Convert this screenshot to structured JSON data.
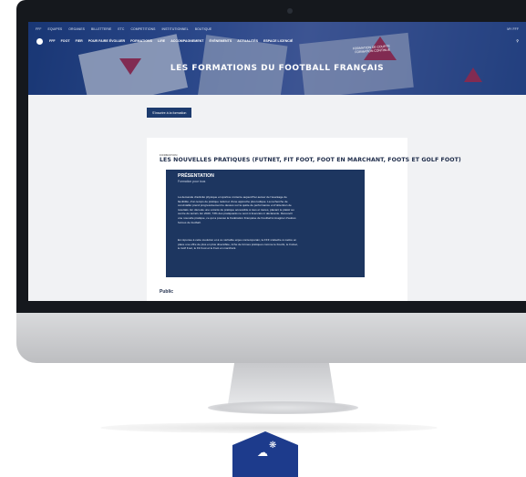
{
  "site": {
    "topbar": {
      "links": [
        "FFF",
        "EQUIPES",
        "ORGANES",
        "BILLETTERIE",
        "ETC",
        "COMPETITIONS",
        "INSTITUTIONNEL",
        "BOUTIQUE"
      ],
      "right": "MY FFF"
    },
    "nav": {
      "items": [
        "FFF",
        "FOOT",
        "FIER",
        "POUR FAIRE ÉVOLUER",
        "FORMATIONS",
        "LIRE",
        "ACCOMPAGNEMENT",
        "ÉVÉNEMENTS",
        "ACTUALITÉS",
        "ESPACE LICENCIÉ"
      ]
    },
    "hero": {
      "title": "LES FORMATIONS DU FOOTBALL FRANÇAIS",
      "badge_line1": "FORMATION DE COURTE",
      "badge_line2": "FORMATION CONTINUE"
    },
    "back_button": "S'inscrire à la formation",
    "card": {
      "tag": "FORMATION",
      "title": "LES NOUVELLES PRATIQUES (FUTNET, FIT FOOT, FOOT EN MARCHANT, FOOTS ET GOLF FOOT)",
      "presentation": {
        "heading": "PRÉSENTATION",
        "subheading": "Formation pour tous",
        "para1": "La demande d'activité physique et sportive s'oriente aujourd'hui autour de l'avantage de flexibilité, d'un temps de pratique réduit et d'une approche plus ludique. La recherche de convivialité prend progressivement le dessus sur la quête de performance et d'obtention de résultats. En découle une volonté de pratique accessible à tous et toutes, placant le plaisir au centre du terrain. En 2020, 73% des pratiquants ne sont ni licenciés ni déclarants. Découvrir une nouvelle pratique, ce qui a poussé la Fédération Française de Football à imaginer d'autres formes de football.",
        "para2": "En réponse à cette évolution et à ce véritable enjeu contemporain, la FFF s'attache à mettre en place une offre de plus en plus diversifiée, riche de formes pratiques comme le FootG, le Futnet, le Golf Foot, le Fit Foot et le Foot en marchant."
      },
      "public_heading": "Public"
    }
  },
  "colors": {
    "brand_navy": "#1d3660",
    "hero_blue": "#2b4a8c",
    "accent_red": "#d8263b",
    "badge_blue": "#1d3b8c"
  },
  "icons": {
    "search": "search-icon",
    "logo": "fff-logo-icon",
    "badge": "idea-bulb-icon"
  }
}
